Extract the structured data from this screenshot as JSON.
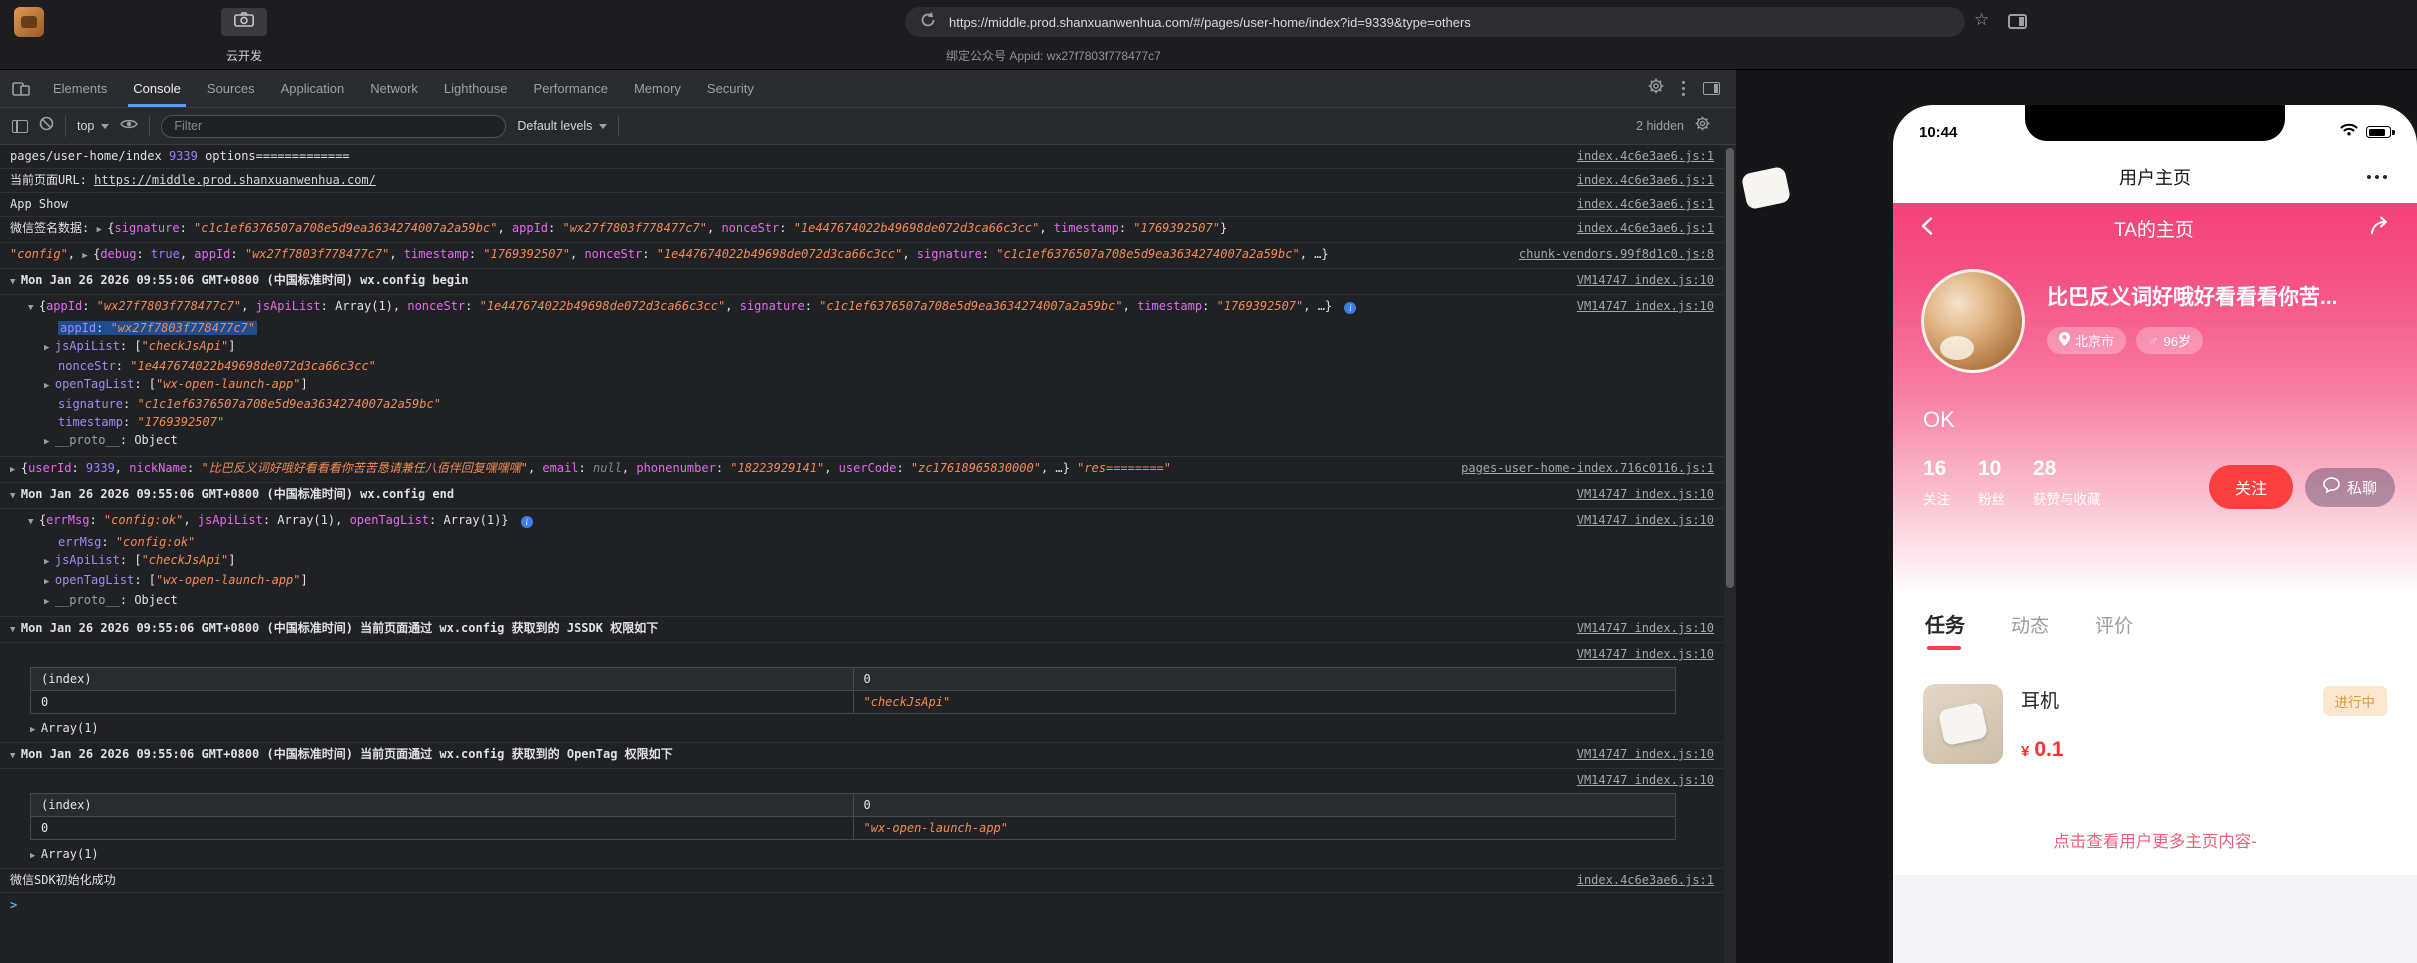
{
  "browser": {
    "url": "https://middle.prod.shanxuanwenhua.com/#/pages/user-home/index?id=9339&type=others",
    "appid_line": "绑定公众号 Appid: wx27f7803f778477c7",
    "cloud_dev_label": "云开发"
  },
  "devtools": {
    "tabs": [
      "Elements",
      "Console",
      "Sources",
      "Application",
      "Network",
      "Lighthouse",
      "Performance",
      "Memory",
      "Security"
    ],
    "active_tab": "Console",
    "toolbar": {
      "context": "top",
      "filter_placeholder": "Filter",
      "levels": "Default levels",
      "hidden_count": "2 hidden"
    }
  },
  "console": {
    "prompt_chevron": ">",
    "messages": [
      {
        "type": "log",
        "link": "index.4c6e3ae6.js:1",
        "tokens": [
          {
            "s": "plain",
            "v": "pages/user-home/index "
          },
          {
            "s": "num",
            "v": "9339"
          },
          {
            "s": "plain",
            "v": " options============="
          }
        ]
      },
      {
        "type": "log",
        "link": "index.4c6e3ae6.js:1",
        "tokens": [
          {
            "s": "plain",
            "v": "当前页面URL: "
          },
          {
            "s": "url",
            "v": "https://middle.prod.shanxuanwenhua.com/"
          }
        ]
      },
      {
        "type": "log",
        "link": "index.4c6e3ae6.js:1",
        "tokens": [
          {
            "s": "plain",
            "v": "App Show"
          }
        ]
      },
      {
        "type": "log",
        "link": "index.4c6e3ae6.js:1",
        "tokens": [
          {
            "s": "plain",
            "v": "微信签名数据: "
          },
          {
            "s": "tri",
            "v": "▶ "
          },
          {
            "s": "plain",
            "v": "{"
          },
          {
            "s": "key",
            "v": "signature"
          },
          {
            "s": "plain",
            "v": ": "
          },
          {
            "s": "str",
            "v": "\"c1c1ef6376507a708e5d9ea3634274007a2a59bc\""
          },
          {
            "s": "plain",
            "v": ", "
          },
          {
            "s": "key",
            "v": "appId"
          },
          {
            "s": "plain",
            "v": ": "
          },
          {
            "s": "str",
            "v": "\"wx27f7803f778477c7\""
          },
          {
            "s": "plain",
            "v": ", "
          },
          {
            "s": "key",
            "v": "nonceStr"
          },
          {
            "s": "plain",
            "v": ": "
          },
          {
            "s": "str",
            "v": "\"1e447674022b49698de072d3ca66c3cc\""
          },
          {
            "s": "plain",
            "v": ", "
          },
          {
            "s": "key",
            "v": "timestamp"
          },
          {
            "s": "plain",
            "v": ": "
          },
          {
            "s": "str",
            "v": "\"1769392507\""
          },
          {
            "s": "plain",
            "v": "}"
          }
        ]
      },
      {
        "type": "log",
        "link": "chunk-vendors.99f8d1c0.js:8",
        "tokens": [
          {
            "s": "str",
            "v": "\"config\""
          },
          {
            "s": "plain",
            "v": ", "
          },
          {
            "s": "tri",
            "v": "▶ "
          },
          {
            "s": "plain",
            "v": "{"
          },
          {
            "s": "key",
            "v": "debug"
          },
          {
            "s": "plain",
            "v": ": "
          },
          {
            "s": "num",
            "v": "true"
          },
          {
            "s": "plain",
            "v": ", "
          },
          {
            "s": "key",
            "v": "appId"
          },
          {
            "s": "plain",
            "v": ": "
          },
          {
            "s": "str",
            "v": "\"wx27f7803f778477c7\""
          },
          {
            "s": "plain",
            "v": ", "
          },
          {
            "s": "key",
            "v": "timestamp"
          },
          {
            "s": "plain",
            "v": ": "
          },
          {
            "s": "str",
            "v": "\"1769392507\""
          },
          {
            "s": "plain",
            "v": ", "
          },
          {
            "s": "key",
            "v": "nonceStr"
          },
          {
            "s": "plain",
            "v": ": "
          },
          {
            "s": "str",
            "v": "\"1e447674022b49698de072d3ca66c3cc\""
          },
          {
            "s": "plain",
            "v": ", "
          },
          {
            "s": "key",
            "v": "signature"
          },
          {
            "s": "plain",
            "v": ": "
          },
          {
            "s": "str",
            "v": "\"c1c1ef6376507a708e5d9ea3634274007a2a59bc\""
          },
          {
            "s": "plain",
            "v": ", …}"
          }
        ]
      },
      {
        "type": "group",
        "bold": true,
        "link": "VM14747 index.js:10",
        "tokens": [
          {
            "s": "tri",
            "v": "▼ "
          },
          {
            "s": "plain",
            "v": "Mon Jan 26 2026 09:55:06 GMT+0800 (中国标准时间) wx.config begin"
          }
        ]
      },
      {
        "type": "log",
        "indent": 1,
        "badge": true,
        "link": "VM14747 index.js:10",
        "tokens": [
          {
            "s": "tri",
            "v": "▼ "
          },
          {
            "s": "plain",
            "v": "{"
          },
          {
            "s": "key",
            "v": "appId"
          },
          {
            "s": "plain",
            "v": ": "
          },
          {
            "s": "str",
            "v": "\"wx27f7803f778477c7\""
          },
          {
            "s": "plain",
            "v": ", "
          },
          {
            "s": "key",
            "v": "jsApiList"
          },
          {
            "s": "plain",
            "v": ": Array(1), "
          },
          {
            "s": "key",
            "v": "nonceStr"
          },
          {
            "s": "plain",
            "v": ": "
          },
          {
            "s": "str",
            "v": "\"1e447674022b49698de072d3ca66c3cc\""
          },
          {
            "s": "plain",
            "v": ", "
          },
          {
            "s": "key",
            "v": "signature"
          },
          {
            "s": "plain",
            "v": ": "
          },
          {
            "s": "str",
            "v": "\"c1c1ef6376507a708e5d9ea3634274007a2a59bc\""
          },
          {
            "s": "plain",
            "v": ", "
          },
          {
            "s": "key",
            "v": "timestamp"
          },
          {
            "s": "plain",
            "v": ": "
          },
          {
            "s": "str",
            "v": "\"1769392507\""
          },
          {
            "s": "plain",
            "v": ", …} "
          }
        ],
        "children": [
          {
            "selected": true,
            "tokens": [
              {
                "s": "key2",
                "v": "appId"
              },
              {
                "s": "plain",
                "v": ": "
              },
              {
                "s": "str",
                "v": "\"wx27f7803f778477c7\""
              }
            ]
          },
          {
            "arrow": true,
            "tokens": [
              {
                "s": "key2",
                "v": "jsApiList"
              },
              {
                "s": "plain",
                "v": ": ["
              },
              {
                "s": "str",
                "v": "\"checkJsApi\""
              },
              {
                "s": "plain",
                "v": "]"
              }
            ]
          },
          {
            "tokens": [
              {
                "s": "key2",
                "v": "nonceStr"
              },
              {
                "s": "plain",
                "v": ": "
              },
              {
                "s": "str",
                "v": "\"1e447674022b49698de072d3ca66c3cc\""
              }
            ]
          },
          {
            "arrow": true,
            "tokens": [
              {
                "s": "key2",
                "v": "openTagList"
              },
              {
                "s": "plain",
                "v": ": ["
              },
              {
                "s": "str",
                "v": "\"wx-open-launch-app\""
              },
              {
                "s": "plain",
                "v": "]"
              }
            ]
          },
          {
            "tokens": [
              {
                "s": "key2",
                "v": "signature"
              },
              {
                "s": "plain",
                "v": ": "
              },
              {
                "s": "str",
                "v": "\"c1c1ef6376507a708e5d9ea3634274007a2a59bc\""
              }
            ]
          },
          {
            "tokens": [
              {
                "s": "key2",
                "v": "timestamp"
              },
              {
                "s": "plain",
                "v": ": "
              },
              {
                "s": "str",
                "v": "\"1769392507\""
              }
            ]
          },
          {
            "arrow": true,
            "tokens": [
              {
                "s": "keyg",
                "v": "__proto__"
              },
              {
                "s": "plain",
                "v": ": Object"
              }
            ]
          }
        ]
      },
      {
        "type": "log",
        "link": "pages-user-home-index.716c0116.js:1",
        "tokens": [
          {
            "s": "tri",
            "v": "▶ "
          },
          {
            "s": "plain",
            "v": "{"
          },
          {
            "s": "key",
            "v": "userId"
          },
          {
            "s": "plain",
            "v": ": "
          },
          {
            "s": "num",
            "v": "9339"
          },
          {
            "s": "plain",
            "v": ", "
          },
          {
            "s": "key",
            "v": "nickName"
          },
          {
            "s": "plain",
            "v": ": "
          },
          {
            "s": "str",
            "v": "\"比巴反义词好哦好看看看你苦苦恳请兼任八佰伴回复嘿嘿嘿\""
          },
          {
            "s": "plain",
            "v": ", "
          },
          {
            "s": "key",
            "v": "email"
          },
          {
            "s": "plain",
            "v": ": "
          },
          {
            "s": "nul",
            "v": "null"
          },
          {
            "s": "plain",
            "v": ", "
          },
          {
            "s": "key",
            "v": "phonenumber"
          },
          {
            "s": "plain",
            "v": ": "
          },
          {
            "s": "str",
            "v": "\"18223929141\""
          },
          {
            "s": "plain",
            "v": ", "
          },
          {
            "s": "key",
            "v": "userCode"
          },
          {
            "s": "plain",
            "v": ": "
          },
          {
            "s": "str",
            "v": "\"zc17618965830000\""
          },
          {
            "s": "plain",
            "v": ", …} "
          },
          {
            "s": "str",
            "v": "\"res========\""
          }
        ]
      },
      {
        "type": "group",
        "bold": true,
        "link": "VM14747 index.js:10",
        "tokens": [
          {
            "s": "tri",
            "v": "▼ "
          },
          {
            "s": "plain",
            "v": "Mon Jan 26 2026 09:55:06 GMT+0800 (中国标准时间) wx.config end"
          }
        ]
      },
      {
        "type": "log",
        "indent": 1,
        "badge": true,
        "link": "VM14747 index.js:10",
        "tokens": [
          {
            "s": "tri",
            "v": "▼ "
          },
          {
            "s": "plain",
            "v": "{"
          },
          {
            "s": "key",
            "v": "errMsg"
          },
          {
            "s": "plain",
            "v": ": "
          },
          {
            "s": "str",
            "v": "\"config:ok\""
          },
          {
            "s": "plain",
            "v": ", "
          },
          {
            "s": "key",
            "v": "jsApiList"
          },
          {
            "s": "plain",
            "v": ": Array(1), "
          },
          {
            "s": "key",
            "v": "openTagList"
          },
          {
            "s": "plain",
            "v": ": Array(1)} "
          }
        ],
        "children": [
          {
            "tokens": [
              {
                "s": "key2",
                "v": "errMsg"
              },
              {
                "s": "plain",
                "v": ": "
              },
              {
                "s": "str",
                "v": "\"config:ok\""
              }
            ]
          },
          {
            "arrow": true,
            "tokens": [
              {
                "s": "key2",
                "v": "jsApiList"
              },
              {
                "s": "plain",
                "v": ": ["
              },
              {
                "s": "str",
                "v": "\"checkJsApi\""
              },
              {
                "s": "plain",
                "v": "]"
              }
            ]
          },
          {
            "arrow": true,
            "tokens": [
              {
                "s": "key2",
                "v": "openTagList"
              },
              {
                "s": "plain",
                "v": ": ["
              },
              {
                "s": "str",
                "v": "\"wx-open-launch-app\""
              },
              {
                "s": "plain",
                "v": "]"
              }
            ]
          },
          {
            "arrow": true,
            "tokens": [
              {
                "s": "keyg",
                "v": "__proto__"
              },
              {
                "s": "plain",
                "v": ": Object"
              }
            ]
          }
        ]
      },
      {
        "type": "group",
        "bold": true,
        "link": "VM14747 index.js:10",
        "tokens": [
          {
            "s": "tri",
            "v": "▼ "
          },
          {
            "s": "plain",
            "v": "Mon Jan 26 2026 09:55:06 GMT+0800 (中国标准时间) 当前页面通过 wx.config 获取到的 JSSDK 权限如下"
          }
        ]
      },
      {
        "type": "table",
        "indent": 1,
        "link": "VM14747 index.js:10",
        "table": {
          "headers": [
            "(index)",
            "0"
          ],
          "rows": [
            [
              "0",
              "\"checkJsApi\""
            ]
          ],
          "footer": "Array(1)"
        }
      },
      {
        "type": "group",
        "bold": true,
        "link": "VM14747 index.js:10",
        "tokens": [
          {
            "s": "tri",
            "v": "▼ "
          },
          {
            "s": "plain",
            "v": "Mon Jan 26 2026 09:55:06 GMT+0800 (中国标准时间) 当前页面通过 wx.config 获取到的 OpenTag 权限如下"
          }
        ]
      },
      {
        "type": "table",
        "indent": 1,
        "link": "VM14747 index.js:10",
        "table": {
          "headers": [
            "(index)",
            "0"
          ],
          "rows": [
            [
              "0",
              "\"wx-open-launch-app\""
            ]
          ],
          "footer": "Array(1)"
        }
      },
      {
        "type": "log",
        "link": "index.4c6e3ae6.js:1",
        "tokens": [
          {
            "s": "plain",
            "v": "微信SDK初始化成功"
          }
        ]
      },
      {
        "type": "prompt"
      }
    ]
  },
  "phone": {
    "status": {
      "time": "10:44"
    },
    "nav_title": "用户主页",
    "hero": {
      "title": "TA的主页",
      "nickname": "比巴反义词好哦好看看看你苦...",
      "location_tag": "北京市",
      "gender_symbol": "♂",
      "gender_text": "96岁",
      "bio": "OK",
      "stats": [
        {
          "value": "16",
          "label": "关注"
        },
        {
          "value": "10",
          "label": "粉丝"
        },
        {
          "value": "28",
          "label": "获赞与收藏"
        }
      ],
      "follow_btn": "关注",
      "chat_btn": "私聊"
    },
    "tabs": [
      {
        "label": "任务",
        "active": true
      },
      {
        "label": "动态",
        "active": false
      },
      {
        "label": "评价",
        "active": false
      }
    ],
    "task": {
      "title": "耳机",
      "status": "进行中",
      "currency": "¥",
      "price": "0.1"
    },
    "footer": "点击查看用户更多主页内容-"
  },
  "colors": {
    "hero_pink": "#f4427a",
    "accent_red": "#fc4040",
    "price_red": "#f8322e",
    "badge_orange": "#dd9a45",
    "tab_underline": "#fb3e49"
  }
}
